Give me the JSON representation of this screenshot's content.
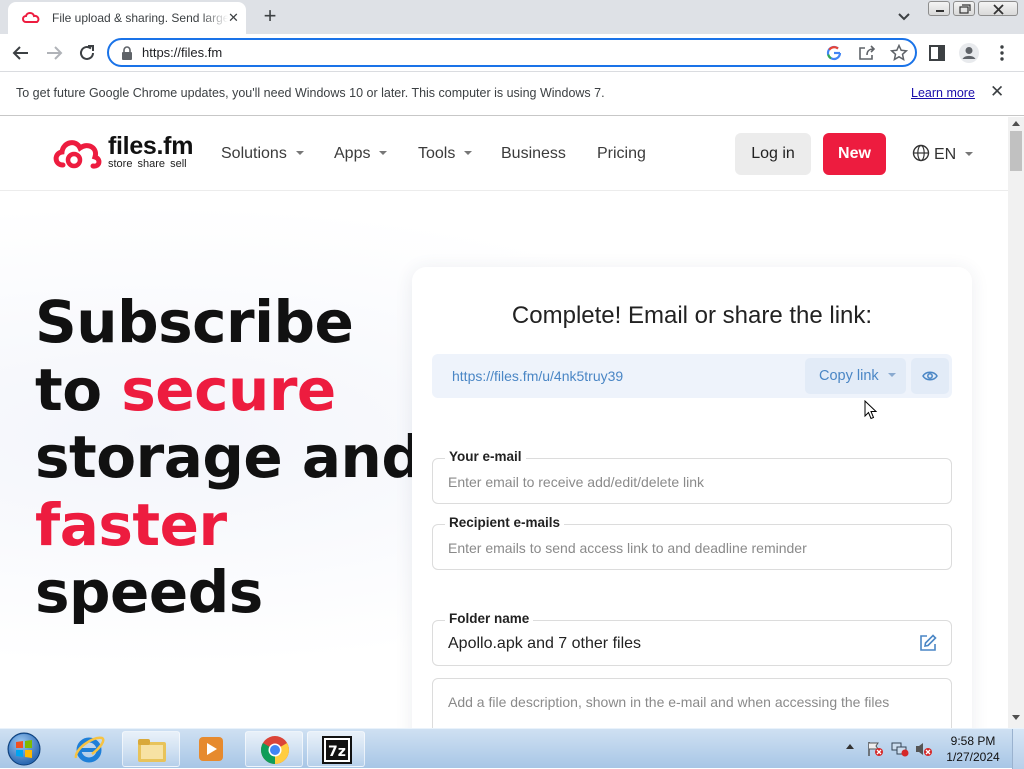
{
  "browser": {
    "tab_title": "File upload & sharing. Send large files",
    "tab_close": "✕",
    "new_tab": "+",
    "url": "https://files.fm"
  },
  "infobar": {
    "message": "To get future Google Chrome updates, you'll need Windows 10 or later. This computer is using Windows 7.",
    "learn_more": "Learn more",
    "close": "✕"
  },
  "site": {
    "logo_text": "files.fm",
    "logo_tagline": "store share sell",
    "nav": [
      "Solutions",
      "Apps",
      "Tools",
      "Business",
      "Pricing"
    ],
    "login": "Log in",
    "new": "New",
    "language": "EN",
    "brand_color": "#ed1c3f"
  },
  "hero": {
    "line1": "Subscribe",
    "line2a": "to",
    "line2b": "secure",
    "line3": "storage and",
    "line4": "faster",
    "line5": "speeds"
  },
  "card": {
    "title": "Complete! Email or share the link:",
    "share_link": "https://files.fm/u/4nk5truy39",
    "copy_link": "Copy link",
    "email_label": "Your e-mail",
    "email_placeholder": "Enter email to receive add/edit/delete link",
    "recipients_label": "Recipient e-mails",
    "recipients_placeholder": "Enter emails to send access link to and deadline reminder",
    "folder_label": "Folder name",
    "folder_value": "Apollo.apk and 7 other files",
    "description_placeholder": "Add a file description, shown in the e-mail and when accessing the files"
  },
  "taskbar": {
    "time": "9:58 PM",
    "date": "1/27/2024"
  }
}
